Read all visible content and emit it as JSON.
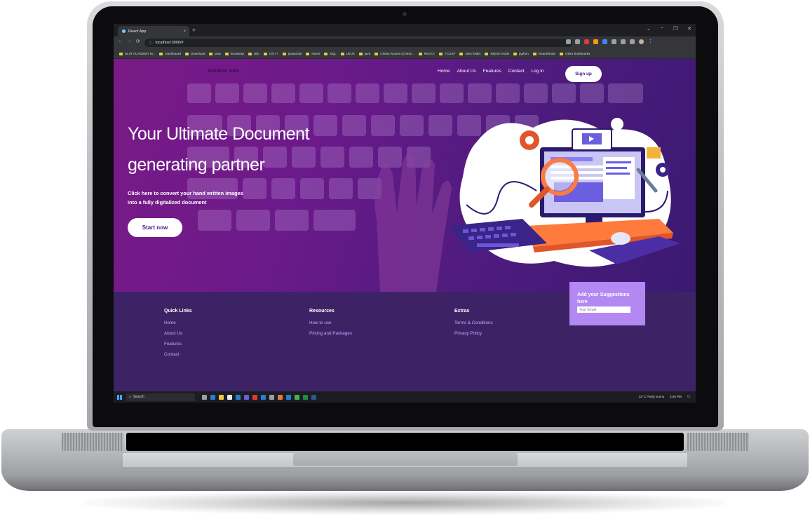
{
  "browser": {
    "tab_title": "React App",
    "tab_close": "×",
    "new_tab": "+",
    "url": "localhost:3000/#",
    "window_controls": [
      "⌄",
      "−",
      "❐",
      "✕"
    ],
    "bookmarks": [
      "SLIIT ACADEMY M...",
      "Dashboard",
      "Download",
      "java",
      "bootstrap",
      "php",
      "C/C++",
      "javascript",
      "Notes",
      "SQL",
      "UI/UX",
      "java",
      "Chess.Rooms (Chess...",
      "REACT",
      "TCSSF",
      "New folder",
      "Skyrim mods",
      "python",
      "React/Node"
    ],
    "other_bookmarks": "Other bookmarks"
  },
  "site": {
    "brand": "DIGIDOC GEN",
    "nav": [
      "Home",
      "About Us",
      "Features",
      "Contact",
      "Log in"
    ],
    "signup_label": "Sign up",
    "headline_line1": "Your Ultimate Document",
    "headline_line2": "generating partner",
    "subtext_line1": "Click here to convert your hand written images",
    "subtext_line2": "into a fully digitalized document",
    "start_label": "Start now",
    "footer": {
      "quick_links_title": "Quick Links",
      "quick_links": [
        "Home",
        "About Us",
        "Features",
        "Contact"
      ],
      "resources_title": "Resources",
      "resources": [
        "How to use",
        "Pricing and Packages"
      ],
      "extras_title": "Extras",
      "extras": [
        "Terms & Conditions",
        "Privacy Policy"
      ],
      "suggest_title_line1": "Add your Suggestions",
      "suggest_title_line2": "here",
      "suggest_placeholder": "Your Email"
    }
  },
  "taskbar": {
    "search_label": "Search",
    "weather": "32°C  Partly sunny",
    "time": "3:46 PM"
  },
  "colors": {
    "hero_start": "#7a1a86",
    "hero_end": "#3a1a72",
    "footer_bg": "#3d2366",
    "footer_link": "#c9a6ff",
    "accent_button_text": "#4a1a8a",
    "suggest_box": "#b388f2"
  }
}
